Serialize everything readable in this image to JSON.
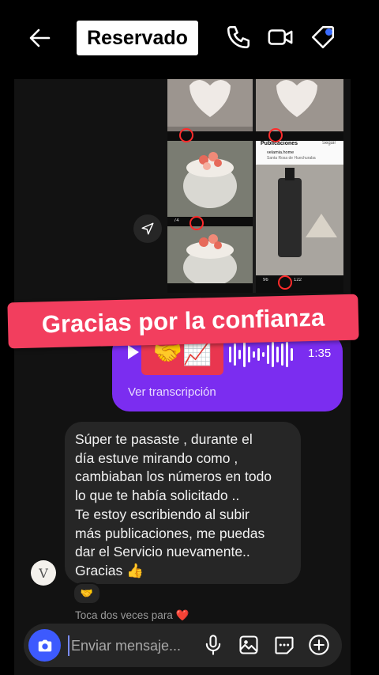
{
  "header": {
    "title": "Reservado",
    "back_icon": "arrow-left-icon",
    "icons": [
      "phone-icon",
      "video-icon",
      "tag-icon"
    ],
    "notification_color": "#3a6cff"
  },
  "shared_post": {
    "feed_title": "Publicaciones",
    "follow_label": "Seguir",
    "account": "velamia.home",
    "location": "Santa Rosa de Huechuraba",
    "likes_a": "74",
    "likes_b": "96",
    "shares_b": "122"
  },
  "banner": {
    "text": "Gracias por la confianza",
    "color": "#f23e5e"
  },
  "voice_message": {
    "emoji": "🤝📈",
    "duration": "1:35",
    "transcription_link": "Ver transcripción",
    "color": "#7b2df0"
  },
  "message": {
    "lines": [
      "Súper te pasaste , durante el",
      "día estuve mirando como ,",
      "cambiaban los números en todo",
      "lo que te había solicitado ..",
      "Te estoy escribiendo al subir",
      "más publicaciones, me puedas",
      "dar el Servicio nuevamente..",
      "Gracias 👍"
    ],
    "reaction": "🤝",
    "avatar_initial": "V"
  },
  "hint": "Toca dos veces para ❤️",
  "composer": {
    "placeholder": "Enviar mensaje...",
    "camera_color": "#3d5afe",
    "icons": [
      "microphone-icon",
      "gallery-icon",
      "sticker-icon",
      "plus-icon"
    ]
  }
}
